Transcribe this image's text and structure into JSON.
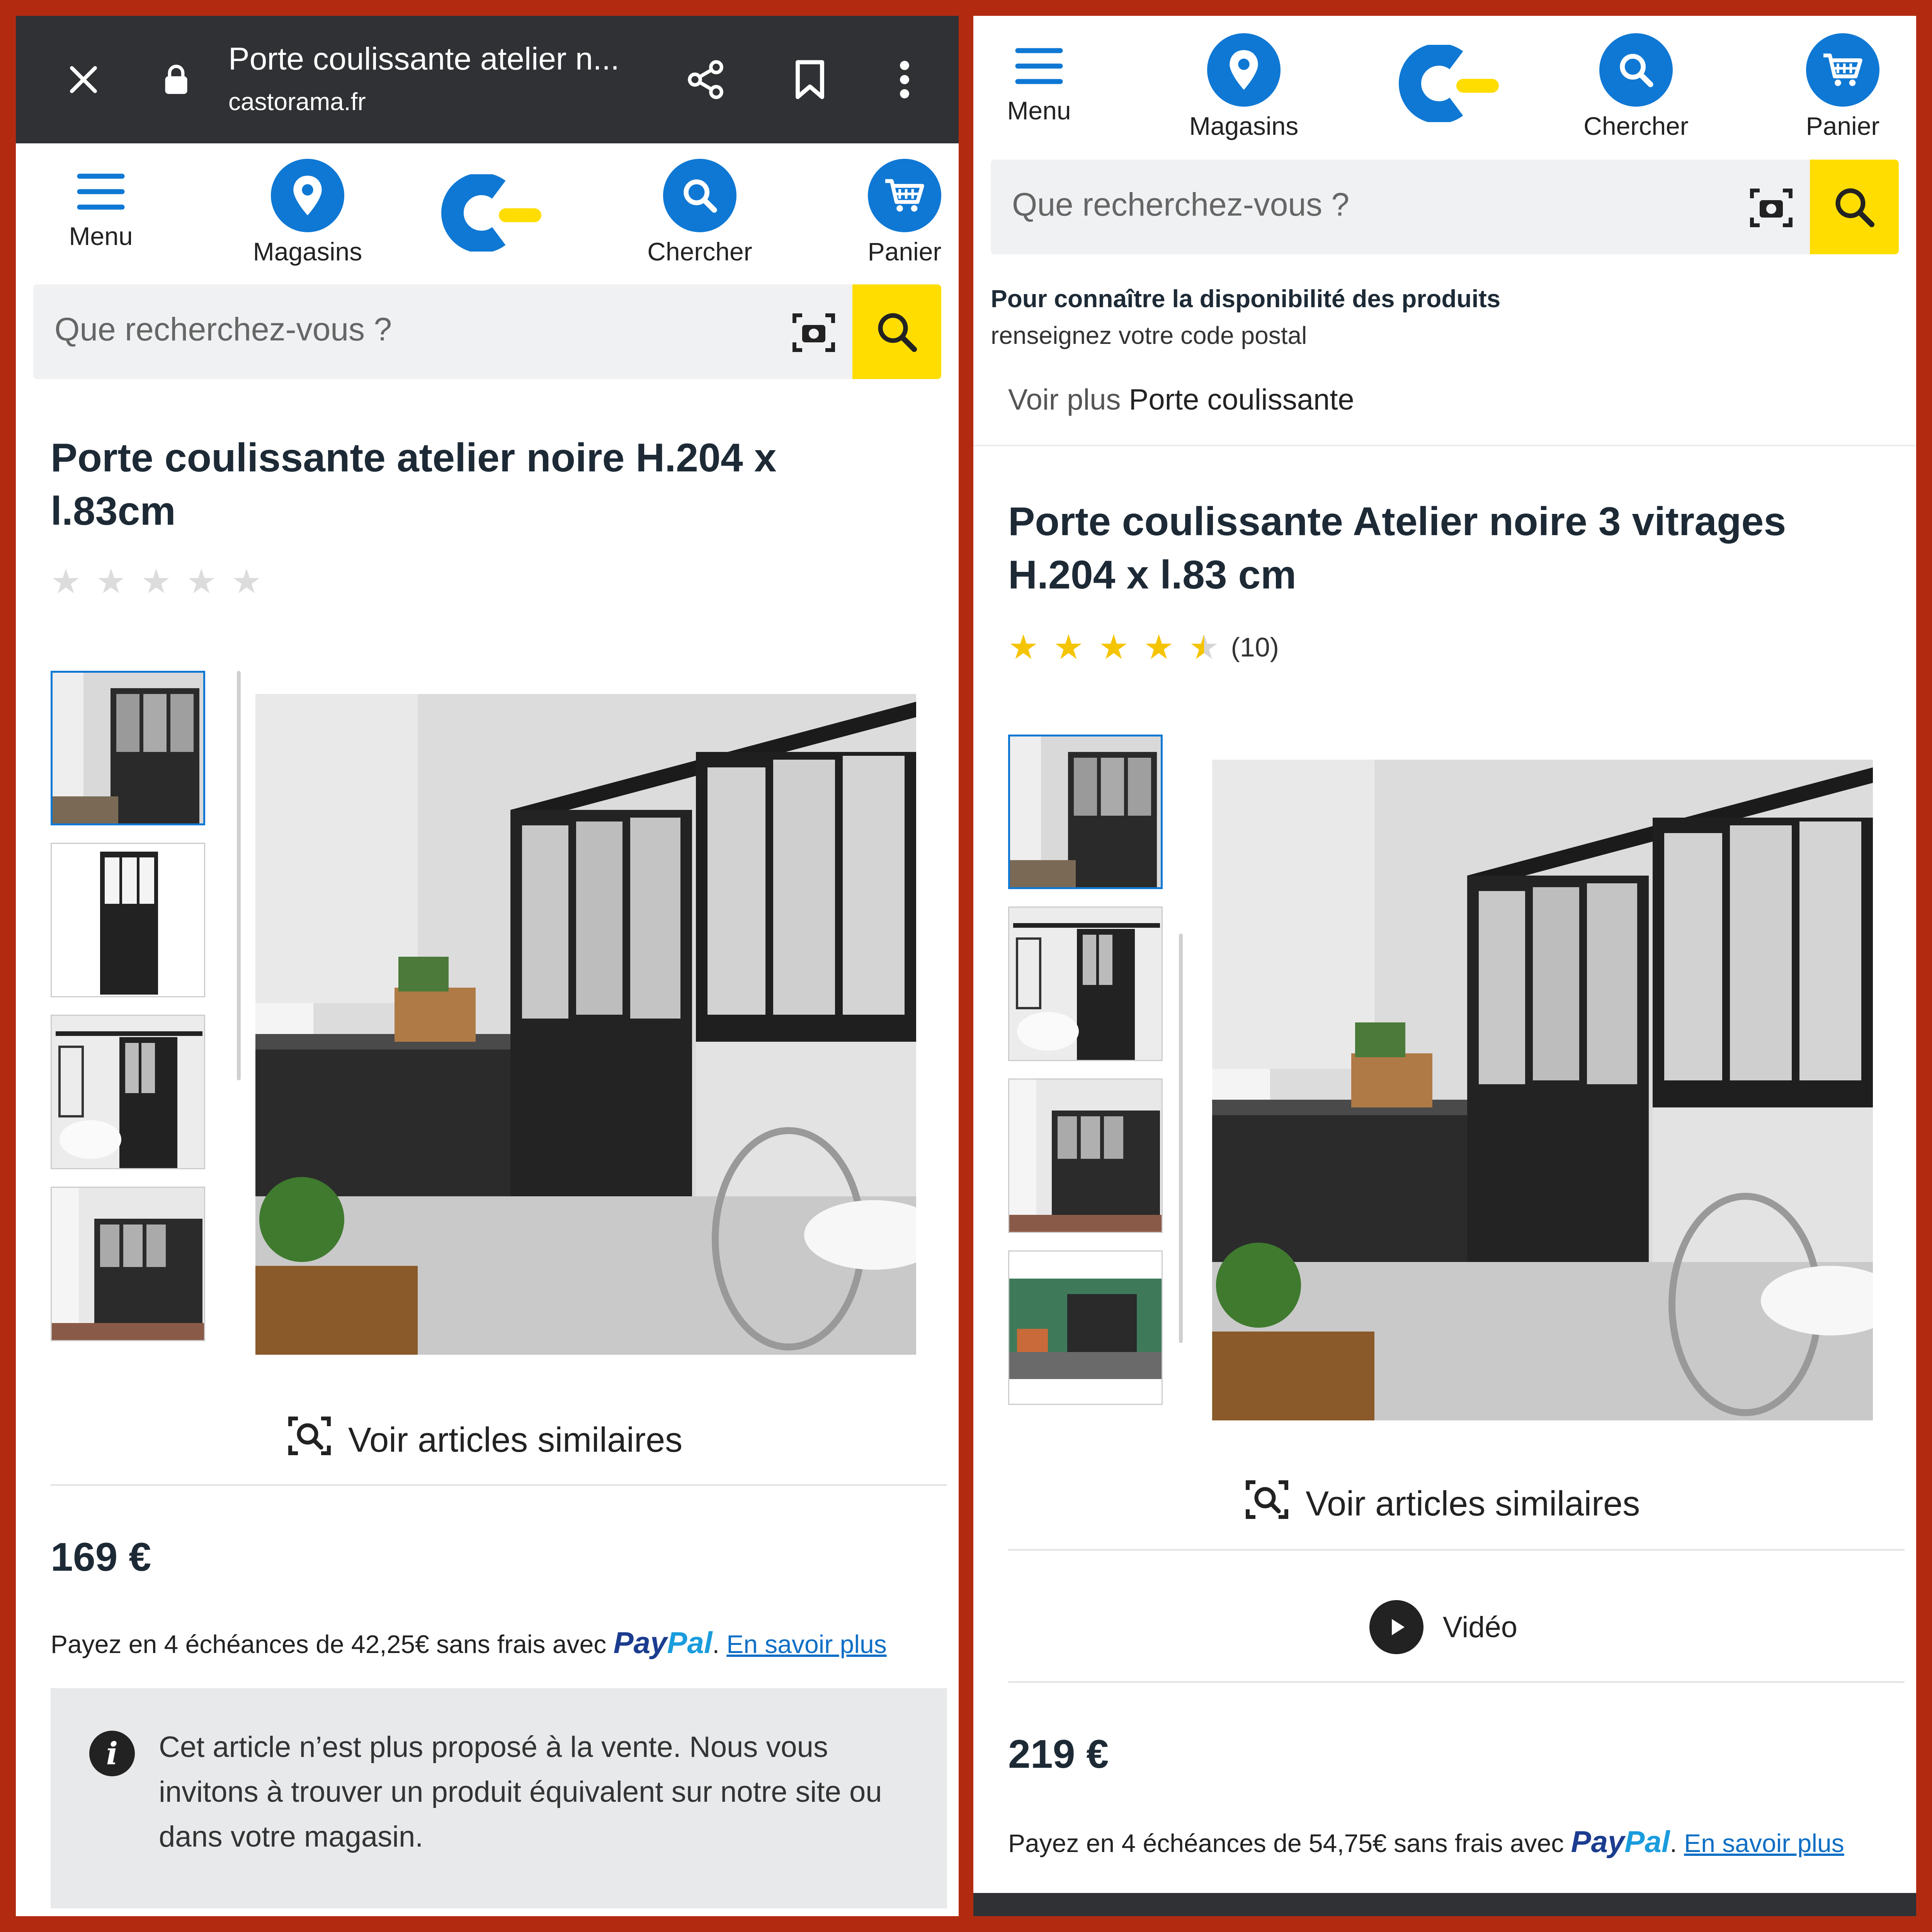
{
  "left": {
    "browser": {
      "title": "Porte coulissante atelier n...",
      "url": "castorama.fr",
      "icons": [
        "close-icon",
        "lock-icon",
        "share-icon",
        "bookmark-icon",
        "more-icon"
      ]
    },
    "nav": {
      "menu": "Menu",
      "stores": "Magasins",
      "search": "Chercher",
      "cart": "Panier"
    },
    "search_placeholder": "Que recherchez-vous ?",
    "product_title": "Porte coulissante atelier noire H.204 x l.83cm",
    "rating": {
      "stars": 0,
      "max": 5
    },
    "similar": "Voir articles similaires",
    "price": "169 €",
    "paypal_prefix": "Payez en 4 échéances de 42,25€ sans frais avec",
    "paypal_brand_a": "Pay",
    "paypal_brand_b": "Pal",
    "learn_more": "En savoir plus",
    "notice": "Cet article n’est plus proposé à la vente. Nous vous invitons à trouver un produit équivalent sur notre site ou dans votre magasin."
  },
  "right": {
    "nav": {
      "menu": "Menu",
      "stores": "Magasins",
      "search": "Chercher",
      "cart": "Panier"
    },
    "search_placeholder": "Que recherchez-vous ?",
    "availability_title": "Pour connaître la disponibilité des produits",
    "availability_sub": "renseignez votre code postal",
    "breadcrumb_prefix": "Voir plus",
    "breadcrumb_link": "Porte coulissante",
    "product_title": "Porte coulissante Atelier noire 3 vitrages H.204 x l.83 cm",
    "rating": {
      "stars": 4.5,
      "max": 5,
      "count": "(10)"
    },
    "similar": "Voir articles similaires",
    "video": "Vidéo",
    "price": "219 €",
    "paypal_prefix": "Payez en 4 échéances de 54,75€ sans frais avec",
    "paypal_brand_a": "Pay",
    "paypal_brand_b": "Pal",
    "learn_more": "En savoir plus"
  },
  "colors": {
    "brand_blue": "#0f78d4",
    "search_yellow": "#ffdd00",
    "star_yellow": "#f5c400",
    "frame_red": "#b22b10"
  }
}
